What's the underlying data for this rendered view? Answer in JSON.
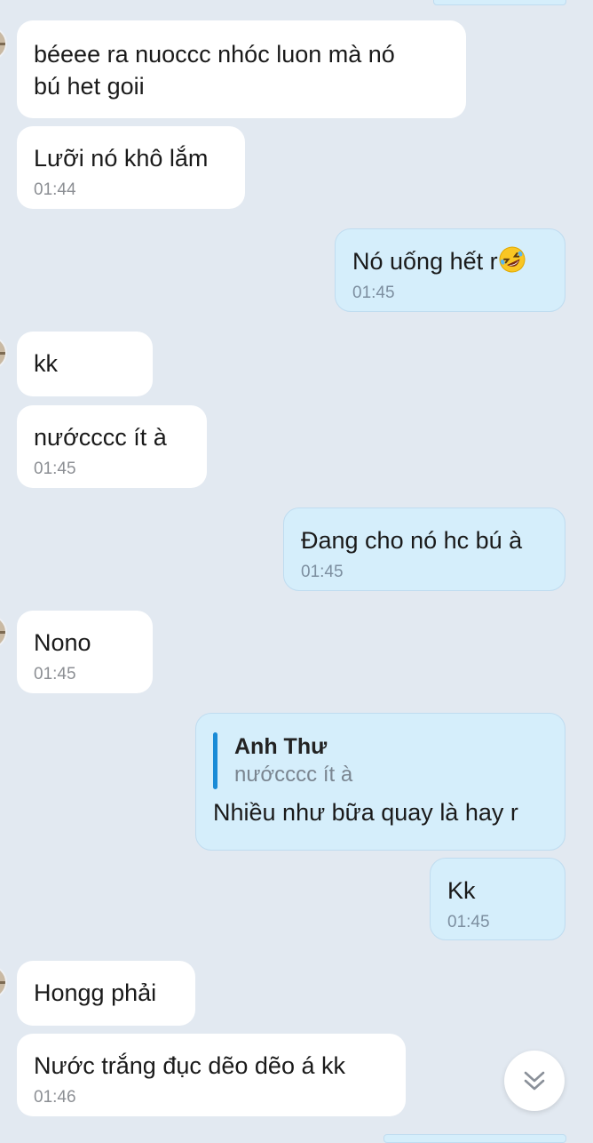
{
  "conversation": {
    "messages": [
      {
        "direction": "in",
        "text": "béeee ra nuoccc nhóc luon mà nó",
        "text2": "bú het goii"
      },
      {
        "direction": "in",
        "text": "Lưỡi nó khô lắm",
        "time": "01:44"
      },
      {
        "direction": "out",
        "text": "Nó uống hết r",
        "emoji": "rolling-on-floor-laughing-emoji",
        "time": "01:45"
      },
      {
        "direction": "in",
        "text": "kk"
      },
      {
        "direction": "in",
        "text": "nướcccc ít à",
        "time": "01:45"
      },
      {
        "direction": "out",
        "text": "Đang cho nó hc bú à",
        "time": "01:45"
      },
      {
        "direction": "in",
        "text": "Nono",
        "time": "01:45"
      },
      {
        "direction": "out",
        "reply_to": {
          "author": "Anh Thư",
          "snippet": "nướcccc ít à"
        },
        "text": "Nhiều như bữa quay là hay r"
      },
      {
        "direction": "out",
        "text": "Kk",
        "time": "01:45"
      },
      {
        "direction": "in",
        "text": "Hongg phải"
      },
      {
        "direction": "in",
        "text": "Nước trắng đục dẽo dẽo á kk",
        "time": "01:46"
      }
    ]
  },
  "colors": {
    "background": "#e2e9f1",
    "incoming_bubble": "#ffffff",
    "outgoing_bubble": "#d5eefb",
    "reply_accent": "#1a8bd6",
    "timestamp": "#8c8f94"
  },
  "icons": {
    "scroll_down": "double-chevron-down-icon"
  }
}
